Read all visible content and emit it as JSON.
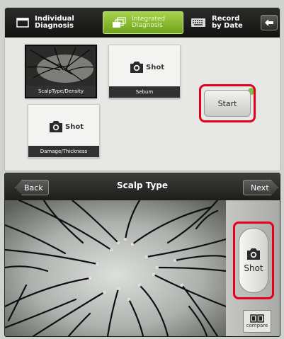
{
  "top": {
    "tabs": [
      {
        "label": "Individual\nDiagnosis",
        "icon": "window-icon",
        "active": false
      },
      {
        "label": "Integrated\nDiagnosis",
        "icon": "stacked-windows-icon",
        "active": true
      },
      {
        "label": "Record\nby Date",
        "icon": "keyboard-icon",
        "active": false
      }
    ],
    "back_icon": "arrow-left-icon",
    "tiles": {
      "scalp": {
        "caption": "ScalpType/Density"
      },
      "sebum": {
        "caption": "Sebum",
        "shot_label": "Shot"
      },
      "damage": {
        "caption": "Damage/Thickness",
        "shot_label": "Shot"
      }
    },
    "start_label": "Start"
  },
  "bottom": {
    "back_label": "Back",
    "title": "Scalp Type",
    "next_label": "Next",
    "shot_label": "Shot",
    "compare_label": "compare"
  },
  "colors": {
    "accent_green": "#8cc63f",
    "highlight_red": "#e3001b"
  }
}
